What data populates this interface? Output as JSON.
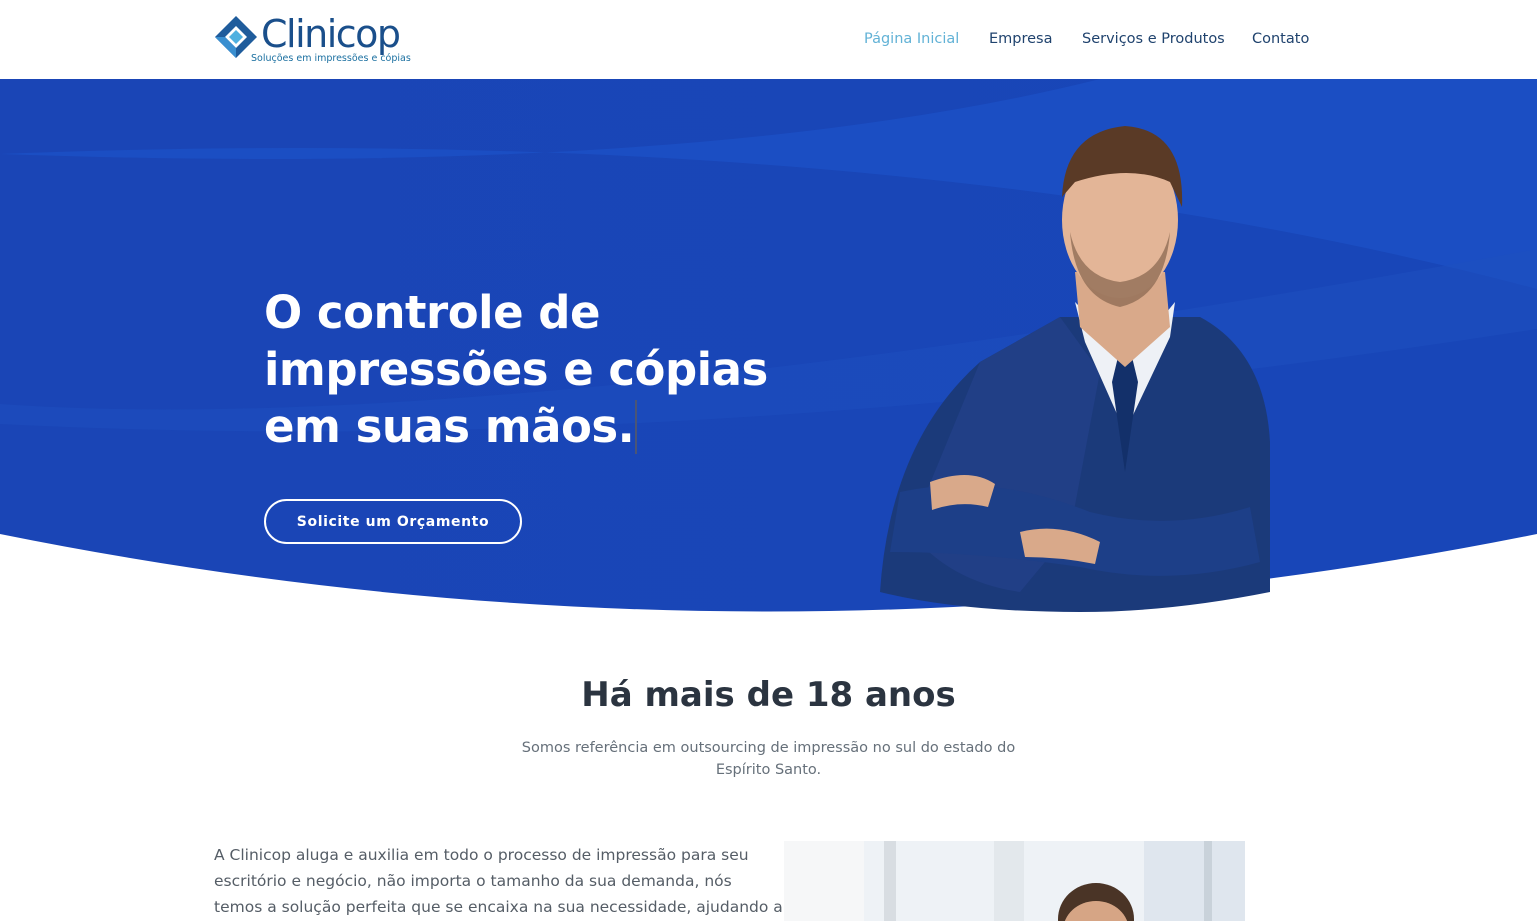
{
  "header": {
    "logo": {
      "name": "Clinicop",
      "tagline": "Soluções em impressões e cópias"
    },
    "nav": [
      {
        "label": "Página Inicial",
        "active": true
      },
      {
        "label": "Empresa",
        "active": false
      },
      {
        "label": "Serviços e Produtos",
        "active": false
      },
      {
        "label": "Contato",
        "active": false
      }
    ]
  },
  "hero": {
    "headline_lines": [
      "O controle de",
      "impressões e cópias",
      "em suas mãos."
    ],
    "cta_label": "Solicite um Orçamento"
  },
  "about": {
    "title": "Há mais de 18 anos",
    "subtitle": "Somos referência em outsourcing de impressão no sul do estado do Espírito Santo.",
    "body_lines": [
      "A Clinicop aluga e auxilia em todo o processo de impressão para seu",
      "escritório e negócio, não importa o tamanho da sua demanda, nós",
      "temos a solução perfeita que se encaixa na sua necessidade, ajudando a"
    ]
  },
  "colors": {
    "hero_blue": "#1a44b8",
    "hero_wave": "#1c51c4",
    "nav_text": "#20436e",
    "nav_active": "#62b2d6",
    "logo_blue": "#1a4f8b"
  },
  "icons": [
    "clinicop-logo-diamond-icon"
  ]
}
